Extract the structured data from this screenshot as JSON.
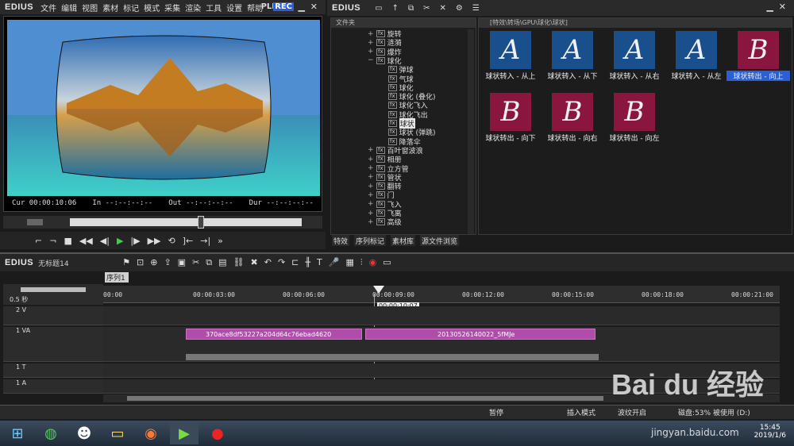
{
  "app": {
    "logo": "EDIUS",
    "menu": [
      "文件",
      "编辑",
      "视图",
      "素材",
      "标记",
      "模式",
      "采集",
      "渲染",
      "工具",
      "设置",
      "帮助"
    ],
    "plr": "PLR",
    "rec": "REC"
  },
  "player": {
    "cur": "Cur 00:00:10:06",
    "in": "In --:--:--:--",
    "out": "Out --:--:--:--",
    "dur": "Dur --:--:--:--"
  },
  "bin": {
    "logo": "EDIUS",
    "folder_header": "文件夹",
    "path": "[特效\\转场\\GPU\\球化\\球状]"
  },
  "tree": [
    {
      "label": "旋转",
      "level": 1
    },
    {
      "label": "涟漪",
      "level": 1
    },
    {
      "label": "爆炸",
      "level": 1
    },
    {
      "label": "球化",
      "level": 1,
      "expanded": true
    },
    {
      "label": "弹球",
      "level": 2
    },
    {
      "label": "气球",
      "level": 2
    },
    {
      "label": "球化",
      "level": 2
    },
    {
      "label": "球化 (叠化)",
      "level": 2
    },
    {
      "label": "球化飞入",
      "level": 2
    },
    {
      "label": "球化飞出",
      "level": 2
    },
    {
      "label": "球状",
      "level": 2,
      "selected": true
    },
    {
      "label": "球状 (弹跳)",
      "level": 2
    },
    {
      "label": "降落伞",
      "level": 2
    },
    {
      "label": "百叶窗波浪",
      "level": 1
    },
    {
      "label": "相册",
      "level": 1
    },
    {
      "label": "立方管",
      "level": 1
    },
    {
      "label": "管状",
      "level": 1
    },
    {
      "label": "翻转",
      "level": 1
    },
    {
      "label": "门",
      "level": 1
    },
    {
      "label": "飞入",
      "level": 1
    },
    {
      "label": "飞离",
      "level": 1
    },
    {
      "label": "高级",
      "level": 1
    }
  ],
  "effects": [
    {
      "letter": "A",
      "label": "球状转入 - 从上",
      "color": "#1a4f8e"
    },
    {
      "letter": "A",
      "label": "球状转入 - 从下",
      "color": "#1a4f8e"
    },
    {
      "letter": "A",
      "label": "球状转入 - 从右",
      "color": "#1a4f8e"
    },
    {
      "letter": "A",
      "label": "球状转入 - 从左",
      "color": "#1a4f8e"
    },
    {
      "letter": "B",
      "label": "球状转出 - 向上",
      "color": "#8a1640",
      "selected": true
    },
    {
      "letter": "B",
      "label": "球状转出 - 向下",
      "color": "#8a1640"
    },
    {
      "letter": "B",
      "label": "球状转出 - 向右",
      "color": "#8a1640"
    },
    {
      "letter": "B",
      "label": "球状转出 - 向左",
      "color": "#8a1640"
    }
  ],
  "tabs": [
    "特效",
    "序列标记",
    "素材库",
    "源文件浏览"
  ],
  "timeline": {
    "logo": "EDIUS",
    "project": "无标题14",
    "sequence": "序列1",
    "zoom": "0.5 秒",
    "ticks": [
      "00:00",
      "00:00:03:00",
      "00:00:06:00",
      "00:00:09:00",
      "00:00:12:00",
      "00:00:15:00",
      "00:00:18:00",
      "00:00:21:00"
    ],
    "cursor_tc": "00:00:10:07",
    "tracks": [
      "2 V",
      "1 VA",
      "1 T",
      "1 A"
    ],
    "clip1": "370ace8df53227a204d64c76ebad4620",
    "clip2": "20130526140022_5fMJe"
  },
  "status": {
    "pause": "暂停",
    "mode": "插入模式",
    "ripple": "波纹开启",
    "disk": "磁盘:53% 被使用 (D:)"
  },
  "clock": {
    "time": "15:45",
    "date": "2019/1/6"
  },
  "watermark": "Bai du 经验",
  "watermark_url": "jingyan.baidu.com"
}
